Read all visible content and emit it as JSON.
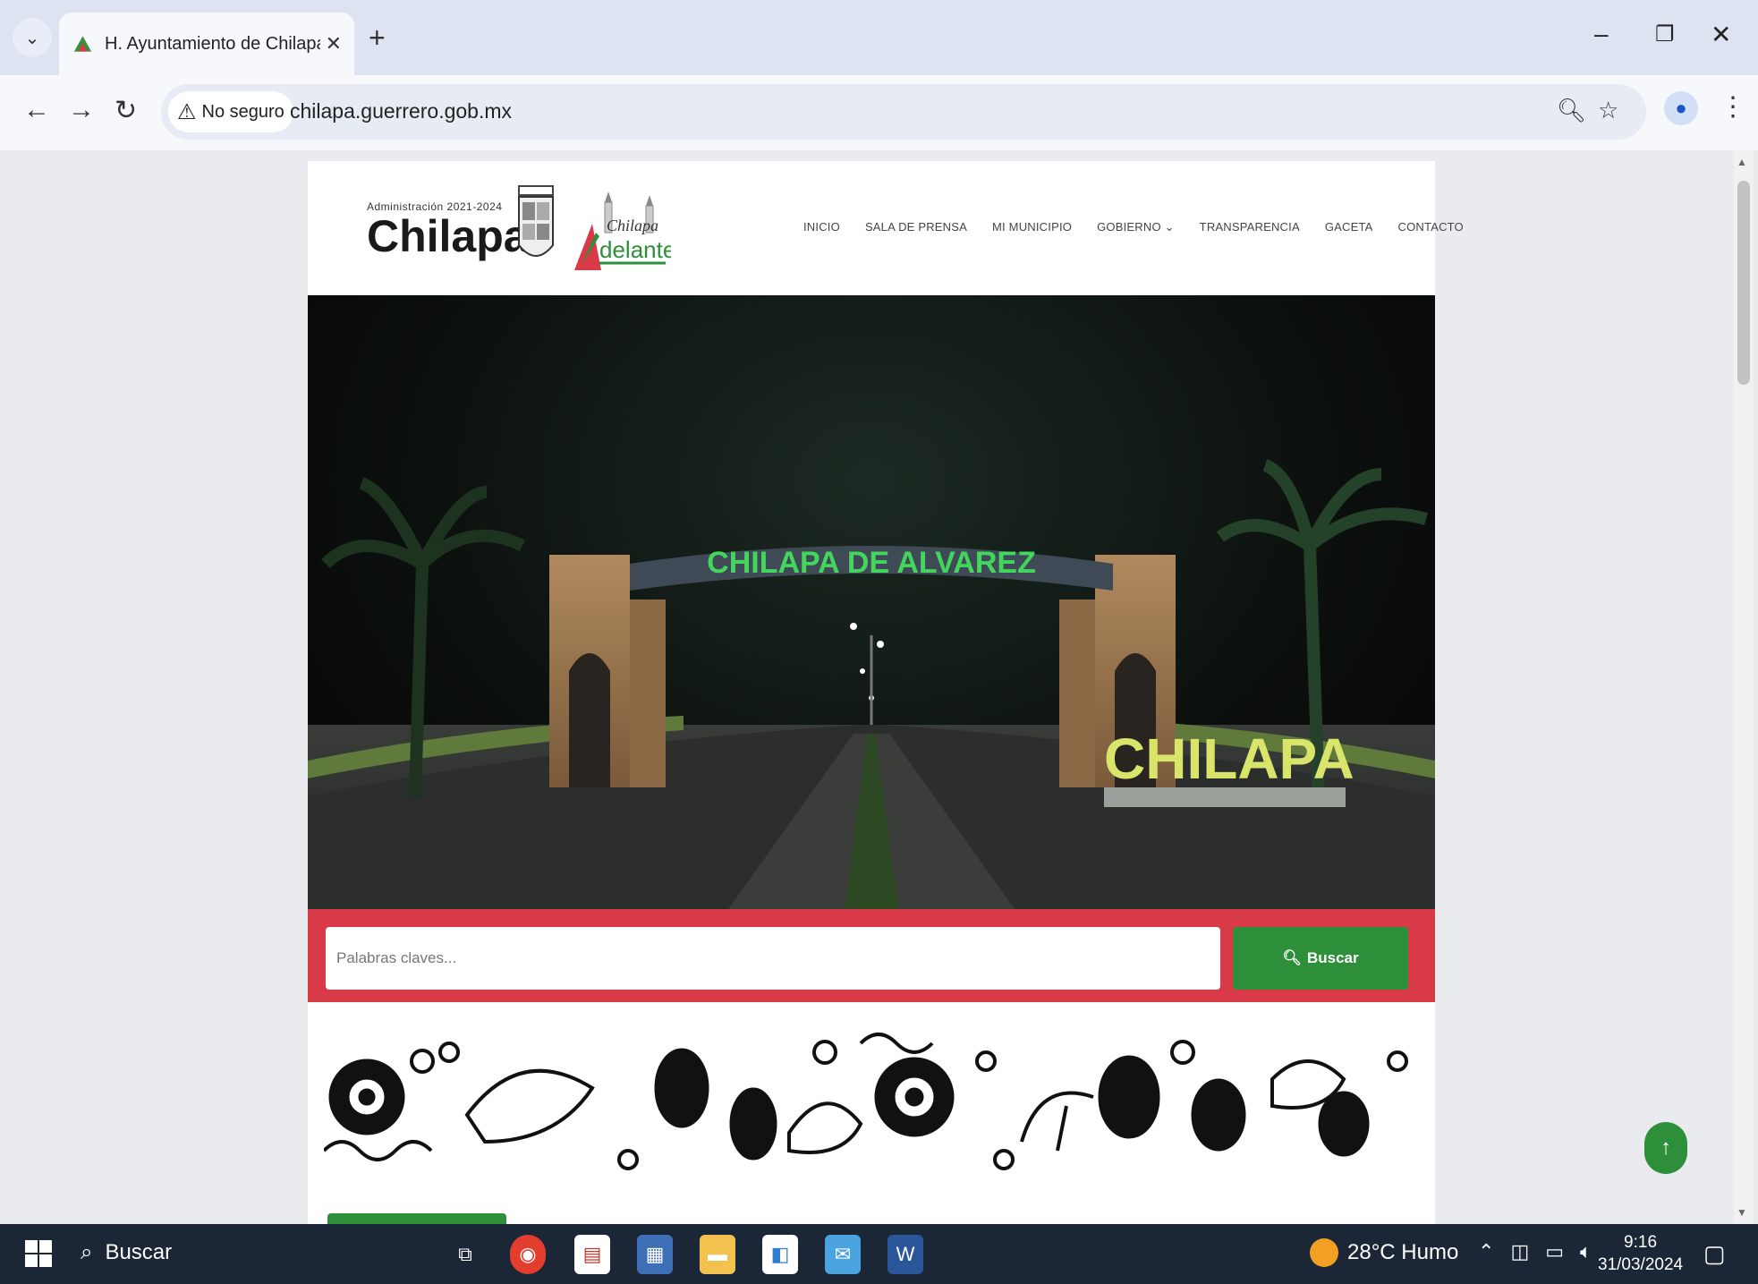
{
  "browser": {
    "tab_title": "H. Ayuntamiento de Chilapa de",
    "security_label": "No seguro",
    "url": "chilapa.guerrero.gob.mx"
  },
  "site": {
    "logo": {
      "admin_text": "Administración 2021-2024",
      "name": "Chilapa"
    },
    "nav": [
      {
        "label": "INICIO"
      },
      {
        "label": "SALA DE PRENSA"
      },
      {
        "label": "MI MUNICIPIO"
      },
      {
        "label": "GOBIERNO ⌄"
      },
      {
        "label": "TRANSPARENCIA"
      },
      {
        "label": "GACETA"
      },
      {
        "label": "CONTACTO"
      }
    ],
    "hero": {
      "arch_text": "CHILAPA  DE  ALVAREZ",
      "sign_text": "CHILAPA"
    },
    "search": {
      "placeholder": "Palabras claves...",
      "button_label": "Buscar"
    }
  },
  "taskbar": {
    "search_label": "Buscar",
    "weather": "28°C  Humo",
    "time": "9:16",
    "date": "31/03/2024"
  },
  "colors": {
    "brand_red": "#d93a48",
    "brand_green": "#2d8f3a"
  }
}
